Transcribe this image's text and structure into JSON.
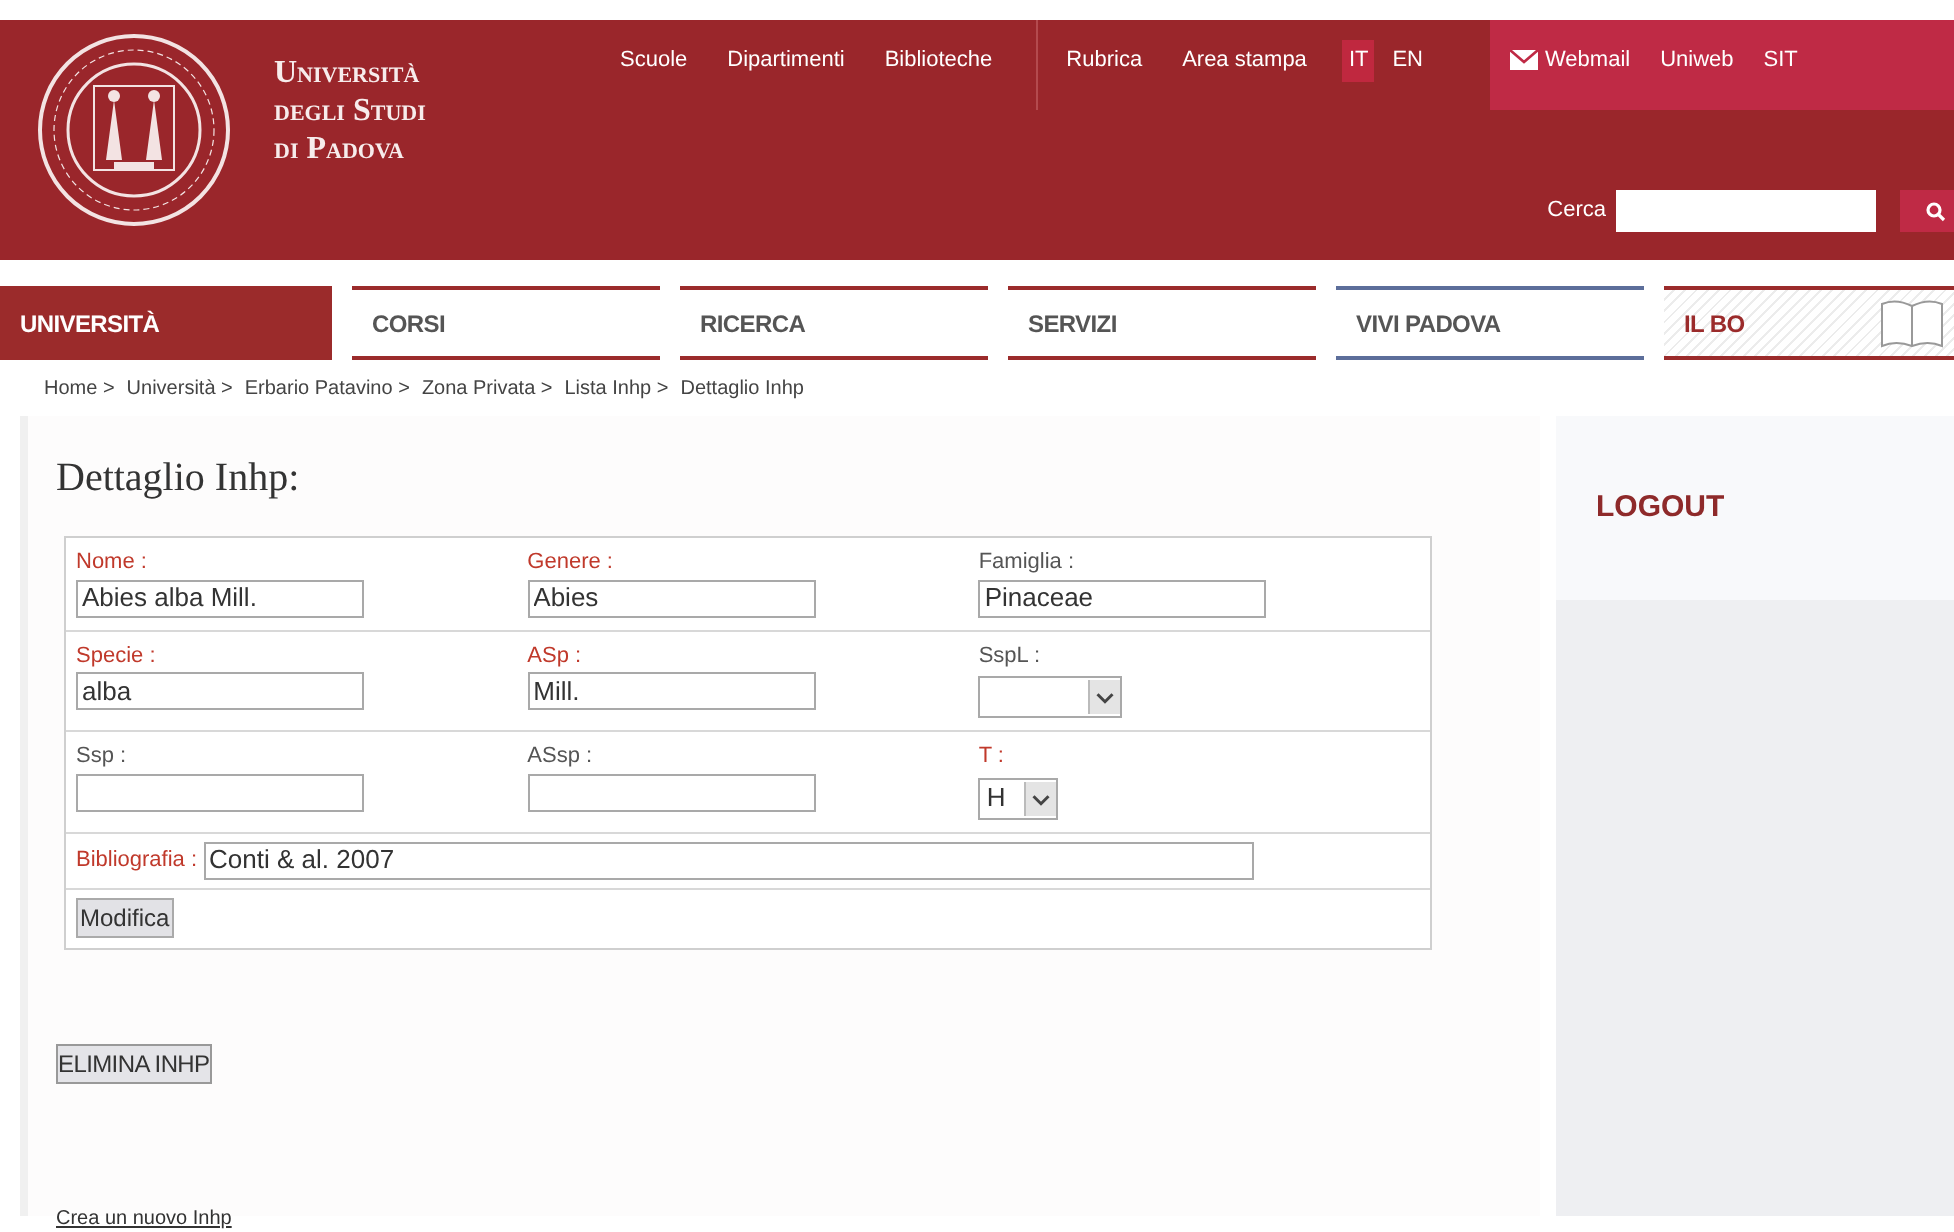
{
  "header": {
    "logo_lines": [
      "Università",
      "degli Studi",
      "di Padova"
    ],
    "top_links": [
      "Scuole",
      "Dipartimenti",
      "Biblioteche",
      "Rubrica",
      "Area stampa"
    ],
    "languages": [
      {
        "label": "IT",
        "selected": true
      },
      {
        "label": "EN",
        "selected": false
      }
    ],
    "service_links": [
      "Webmail",
      "Uniweb",
      "SIT"
    ],
    "search": {
      "label": "Cerca"
    }
  },
  "nav": [
    {
      "label": "UNIVERSITÀ",
      "selected": true,
      "color": "#9b2b2b",
      "kind": "plain"
    },
    {
      "label": "CORSI",
      "selected": false,
      "color": "#9b2b2b",
      "kind": "plain"
    },
    {
      "label": "RICERCA",
      "selected": false,
      "color": "#9b2b2b",
      "kind": "plain"
    },
    {
      "label": "SERVIZI",
      "selected": false,
      "color": "#9b2b2b",
      "kind": "plain"
    },
    {
      "label": "VIVI PADOVA",
      "selected": false,
      "color": "#5c6e9a",
      "kind": "plain"
    },
    {
      "label": "IL BO",
      "selected": false,
      "color": "#9b2b2b",
      "kind": "hatched"
    }
  ],
  "breadcrumb": [
    "Home >",
    "Università >",
    "Erbario Patavino >",
    "Zona Privata >",
    "Lista Inhp >",
    "Dettaglio Inhp"
  ],
  "title": "Dettaglio Inhp:",
  "form_rows": [
    [
      {
        "label": "Nome :",
        "required": true,
        "kind": "text",
        "value": "Abies alba Mill."
      },
      {
        "label": "Genere :",
        "required": true,
        "kind": "text",
        "value": "Abies"
      },
      {
        "label": "Famiglia :",
        "required": false,
        "kind": "text",
        "value": "Pinaceae"
      }
    ],
    [
      {
        "label": "Specie :",
        "required": true,
        "kind": "text",
        "value": "alba"
      },
      {
        "label": "ASp :",
        "required": true,
        "kind": "text",
        "value": "Mill."
      },
      {
        "label": "SspL :",
        "required": false,
        "kind": "select"
      }
    ],
    [
      {
        "label": "Ssp :",
        "required": false,
        "kind": "text"
      },
      {
        "label": "ASsp :",
        "required": false,
        "kind": "text"
      },
      {
        "label": "T :",
        "required": true,
        "kind": "select",
        "value": "H"
      }
    ]
  ],
  "bibliografia": {
    "label": "Bibliografia :",
    "required": true,
    "value": "Conti & al. 2007"
  },
  "submit": "Modifica",
  "delete_button": "ELIMINA INHP",
  "new_link": "Crea un nuovo Inhp",
  "sidebar": {
    "logout": "LOGOUT"
  }
}
